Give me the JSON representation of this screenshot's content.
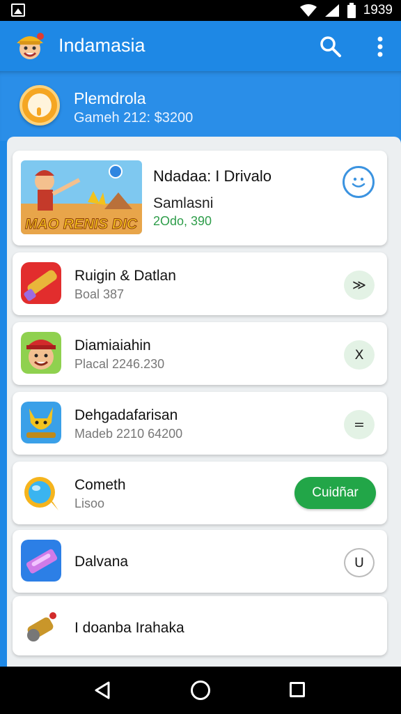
{
  "status_bar": {
    "time": "1939",
    "icons": [
      "gallery-icon",
      "wifi-icon",
      "signal-icon",
      "battery-icon"
    ]
  },
  "app_bar": {
    "title": "Indamasia",
    "icons": [
      "app-logo",
      "search-icon",
      "more-vert-icon"
    ]
  },
  "profile": {
    "name": "Plemdrola",
    "subtitle": "Gameh 212: $3200"
  },
  "featured": {
    "title": "Ndadaa: I Drivalo",
    "subtitle": "Samlasni",
    "meta": "2Odo, 390",
    "banner_text": "MAO RENIS DIC",
    "action_icon": "smiley-icon"
  },
  "items": [
    {
      "title": "Ruigin & Datlan",
      "subtitle": "Boal 387",
      "action": "≫",
      "icon": "cannon-icon"
    },
    {
      "title": "Diamiaiahin",
      "subtitle": "Placal 2246.230",
      "action": "X",
      "icon": "red-cap-character-icon"
    },
    {
      "title": "Dehgadafarisan",
      "subtitle": "Madeb 2210 64200",
      "action": "=",
      "icon": "cat-character-icon"
    },
    {
      "title": "Cometh",
      "subtitle": "Lisoo",
      "action": "Cuidñar",
      "icon": "gem-bubble-icon"
    },
    {
      "title": "Dalvana",
      "subtitle": "",
      "action": "U",
      "icon": "crystal-icon"
    },
    {
      "title": "I doanba Irahaka",
      "subtitle": "",
      "action": "",
      "icon": "golden-cannon-icon"
    }
  ],
  "colors": {
    "primary": "#1e88e5",
    "accent_green": "#22a648",
    "meta_green": "#2e9d4a"
  }
}
